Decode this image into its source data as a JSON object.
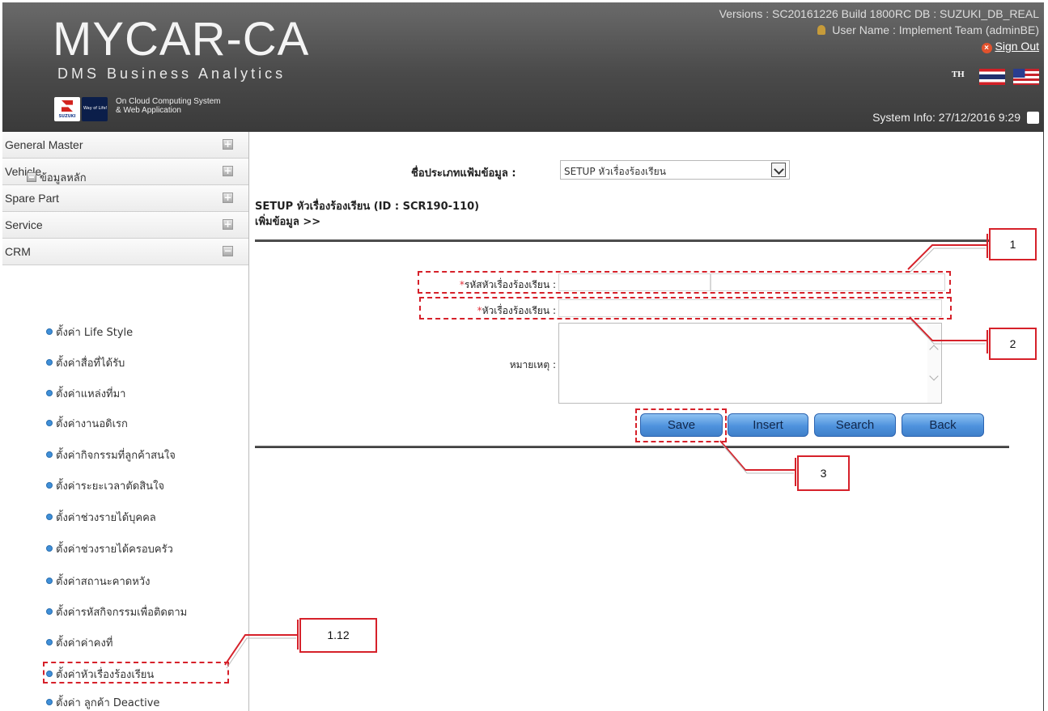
{
  "header": {
    "title": "MYCAR-CA",
    "subtitle": "DMS Business Analytics",
    "tagline_line1": "On Cloud Computing System",
    "tagline_line2": "& Web Application",
    "versions": "Versions : SC20161226 Build 1800RC DB : SUZUKI_DB_REAL",
    "user_name": "User Name : Implement Team (adminBE)",
    "sign_out": "Sign Out",
    "lang_th": "TH",
    "system_info": "System Info: 27/12/2016 9:29"
  },
  "sidebar": {
    "sections": [
      {
        "label": "General Master",
        "toggle": "+"
      },
      {
        "label": "Vehicle",
        "toggle": "+"
      },
      {
        "label": "Spare Part",
        "toggle": "+"
      },
      {
        "label": "Service",
        "toggle": "+"
      },
      {
        "label": "CRM",
        "toggle": "−"
      }
    ],
    "tree_root": "ข้อมูลหลัก",
    "items": [
      "ตั้งค่า Life Style",
      "ตั้งค่าสื่อที่ได้รับ",
      "ตั้งค่าแหล่งที่มา",
      "ตั้งค่างานอดิเรก",
      "ตั้งค่ากิจกรรมที่ลูกค้าสนใจ",
      "ตั้งค่าระยะเวลาตัดสินใจ",
      "ตั้งค่าช่วงรายได้บุคคล",
      "ตั้งค่าช่วงรายได้ครอบครัว",
      "ตั้งค่าสถานะคาดหวัง",
      "ตั้งค่ารหัสกิจกรรมเพื่อติดตาม",
      "ตั้งค่าค่าคงที่",
      "ตั้งค่าหัวเรื่องร้องเรียน",
      "ตั้งค่า ลูกค้า Deactive"
    ]
  },
  "main": {
    "datatype_label": "ชื่อประเภทแฟ้มข้อมูล :",
    "datatype_value": "SETUP หัวเรื่องร้องเรียน",
    "page_title": "SETUP หัวเรื่องร้องเรียน (ID : SCR190-110)",
    "add_data": "เพิ่มข้อมูล >>",
    "form": {
      "code_label": "รหัสหัวเรื่องร้องเรียน :",
      "subject_label": "หัวเรื่องร้องเรียน :",
      "remark_label": "หมายเหตุ :",
      "required_mark": "*"
    },
    "buttons": {
      "save": "Save",
      "insert": "Insert",
      "search": "Search",
      "back": "Back"
    }
  },
  "annotations": {
    "a1": "1",
    "a2": "2",
    "a3": "3",
    "a112": "1.12"
  },
  "colors": {
    "annotation": "#d6212a",
    "button": "#4e92dd",
    "header_bg": "#4a4a4a"
  }
}
